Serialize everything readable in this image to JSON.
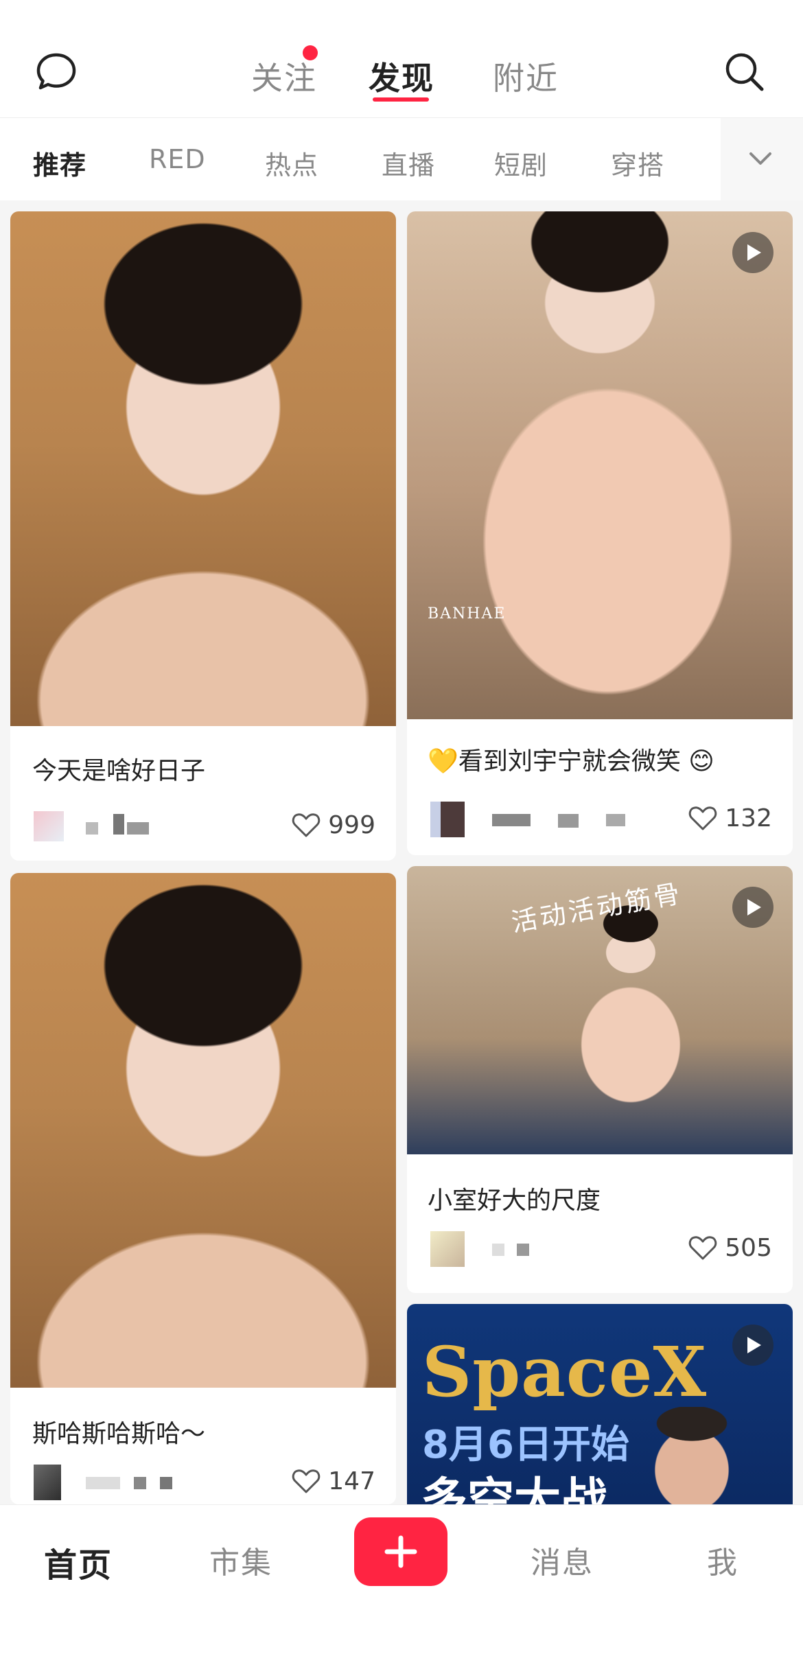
{
  "header": {
    "tabs": [
      {
        "label": "关注",
        "has_dot": true
      },
      {
        "label": "发现",
        "active": true
      },
      {
        "label": "附近"
      }
    ],
    "icons": {
      "left": "chat-bubble-icon",
      "right": "search-icon"
    },
    "accent": "#ff2442"
  },
  "categories": [
    "推荐",
    "RED",
    "热点",
    "直播",
    "短剧",
    "穿搭"
  ],
  "feed": {
    "left": [
      {
        "title": "今天是啥好日子",
        "likes": "999",
        "video": false
      },
      {
        "title": "斯哈斯哈斯哈～",
        "likes": "147",
        "video": false
      }
    ],
    "right": [
      {
        "title": "💛看到刘宇宁就会微笑 😊",
        "likes": "132",
        "video": true,
        "watermark": "BANHAE"
      },
      {
        "title": "小室好大的尺度",
        "likes": "505",
        "video": true,
        "overlay": "活动活动筋骨"
      },
      {
        "title": "",
        "video": true,
        "ad": {
          "line1": "SpaceX",
          "line2": "8月6日开始",
          "line3": "多空大战"
        }
      }
    ]
  },
  "bottom_nav": {
    "items": [
      "首页",
      "市集",
      "消息",
      "我"
    ],
    "active": "首页",
    "add_icon": "plus-icon"
  }
}
